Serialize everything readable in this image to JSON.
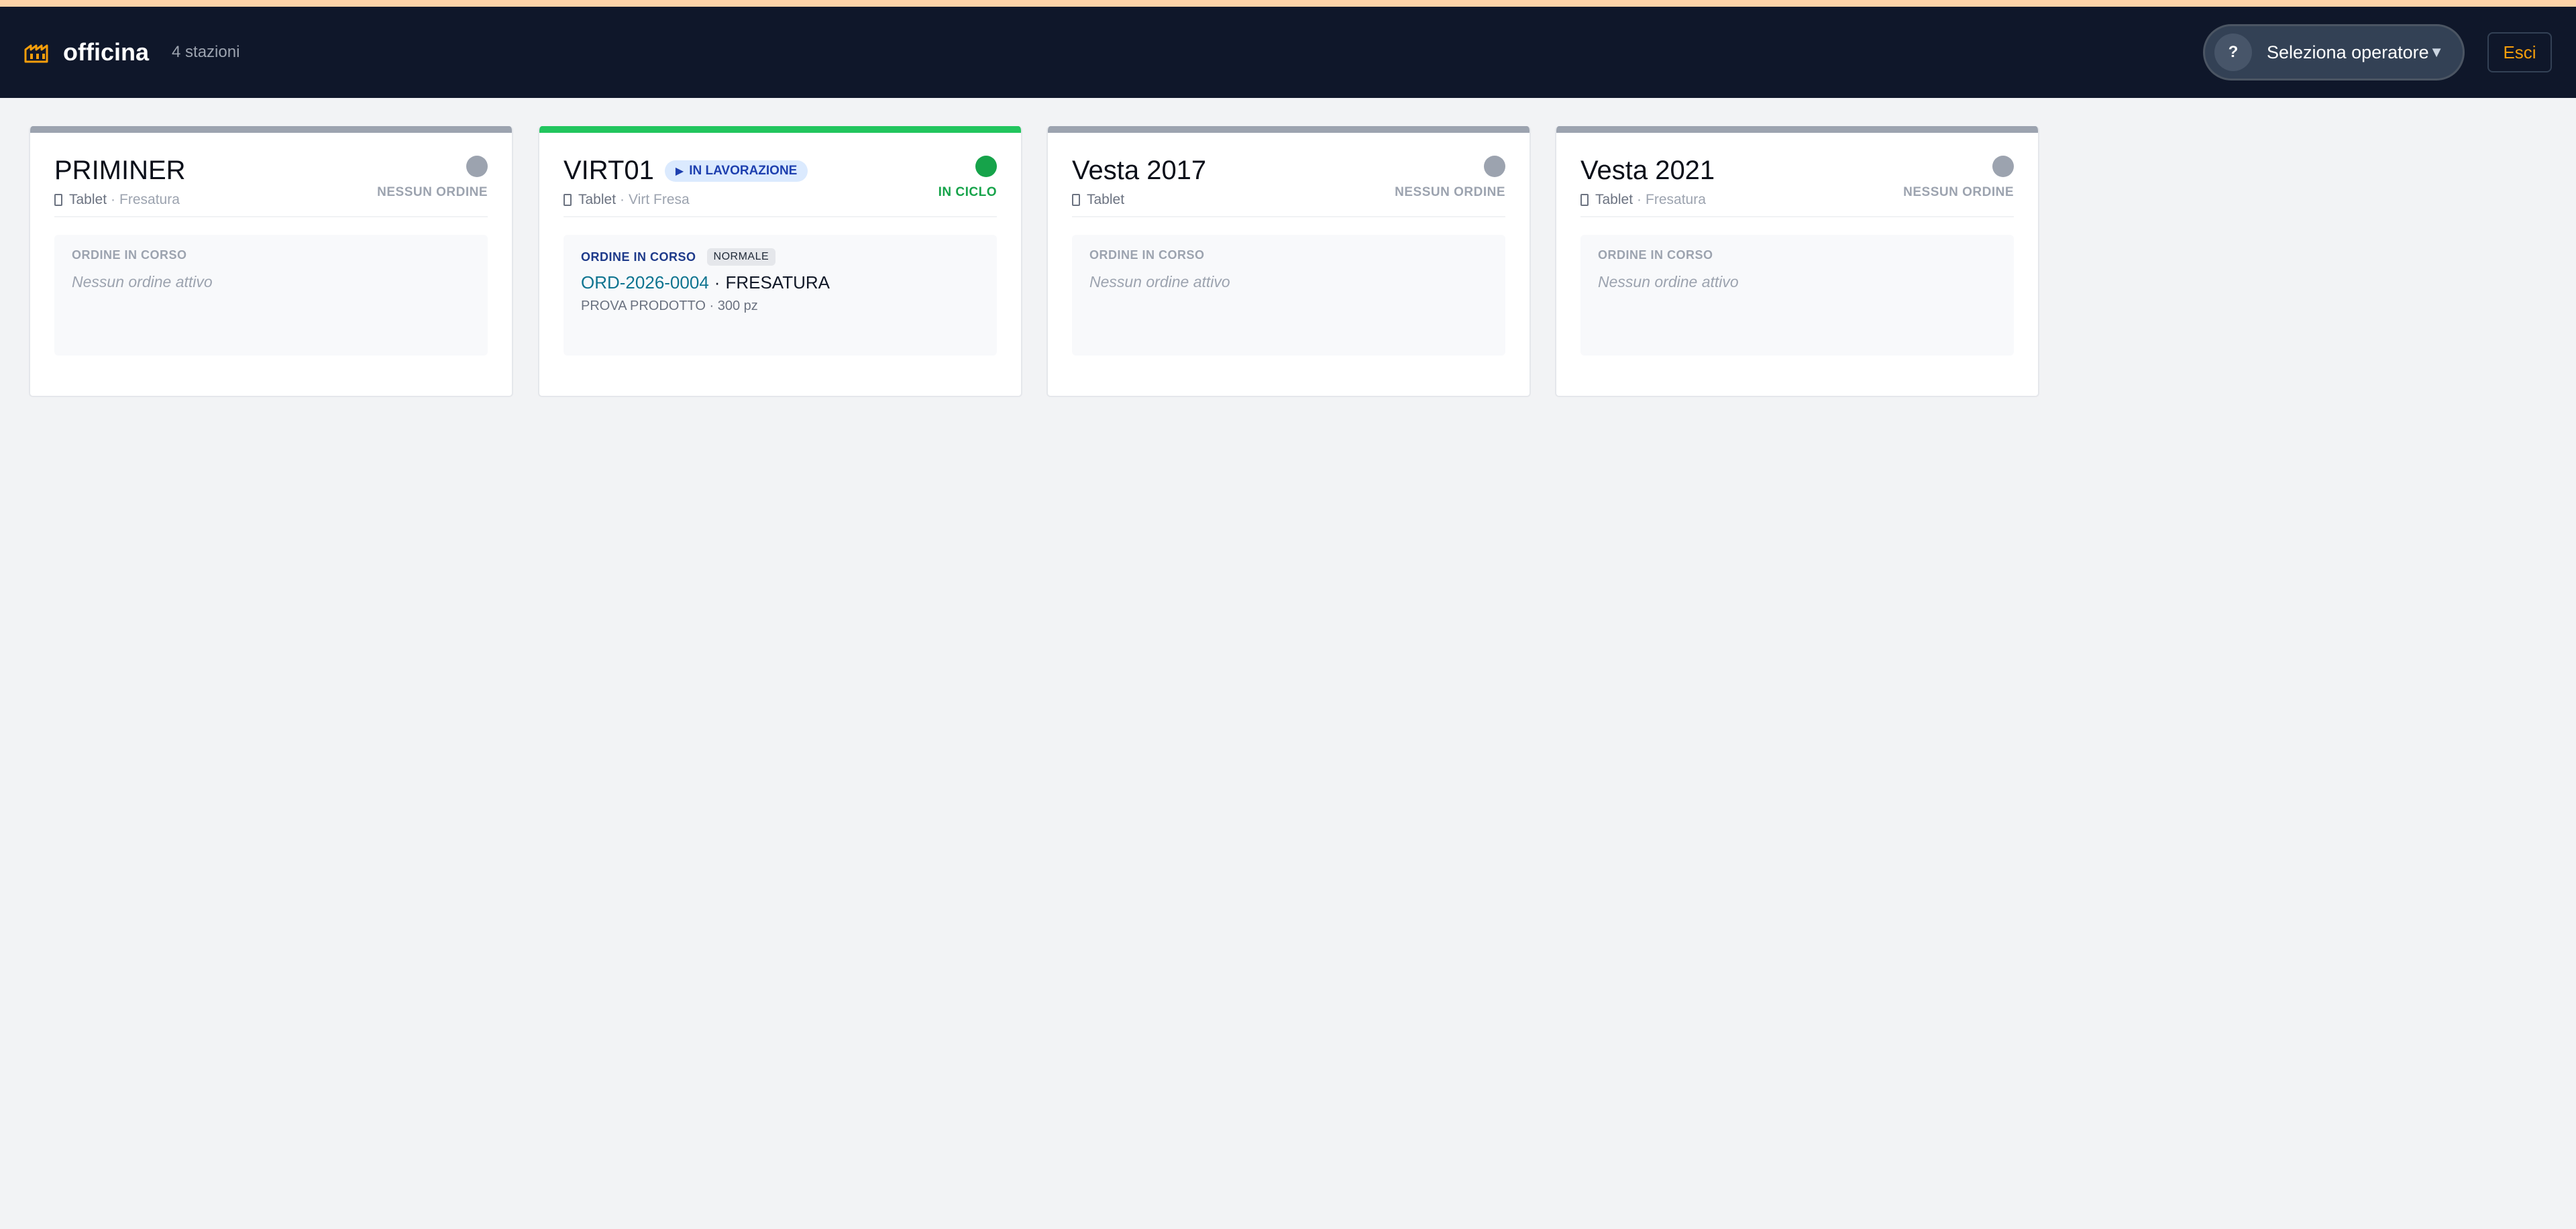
{
  "header": {
    "brand": "officina",
    "stations_count": "4 stazioni",
    "operator_avatar": "?",
    "operator_label": "Seleziona operatore",
    "operator_caret": "▼",
    "exit_label": "Esci"
  },
  "colors": {
    "accent": "#f59e0b",
    "header_bg": "#0f172a",
    "active_green": "#22c55e",
    "idle_gray": "#9ca3af",
    "code_teal": "#0e7490"
  },
  "icons": {
    "brand": "factory-icon",
    "device": "tablet-icon",
    "play": "play-icon"
  },
  "stations": [
    {
      "name": "PRIMINER",
      "device": "Tablet",
      "sep": "·",
      "department": "Fresatura",
      "status": "NESSUN ORDINE",
      "order_caption": "ORDINE IN CORSO",
      "order_empty": "Nessun ordine attivo"
    },
    {
      "name": "VIRT01",
      "pill_play": "▶",
      "pill": "IN LAVORAZIONE",
      "device": "Tablet",
      "sep": "·",
      "department": "Virt Fresa",
      "status": "IN CICLO",
      "order_caption": "ORDINE IN CORSO",
      "priority": "NORMALE",
      "order_code": "ORD-2026-0004",
      "order_dot": "·",
      "order_phase": "FRESATURA",
      "order_product": "PROVA PRODOTTO · 300 pz"
    },
    {
      "name": "Vesta 2017",
      "device": "Tablet",
      "status": "NESSUN ORDINE",
      "order_caption": "ORDINE IN CORSO",
      "order_empty": "Nessun ordine attivo"
    },
    {
      "name": "Vesta 2021",
      "device": "Tablet",
      "sep": "·",
      "department": "Fresatura",
      "status": "NESSUN ORDINE",
      "order_caption": "ORDINE IN CORSO",
      "order_empty": "Nessun ordine attivo"
    }
  ]
}
